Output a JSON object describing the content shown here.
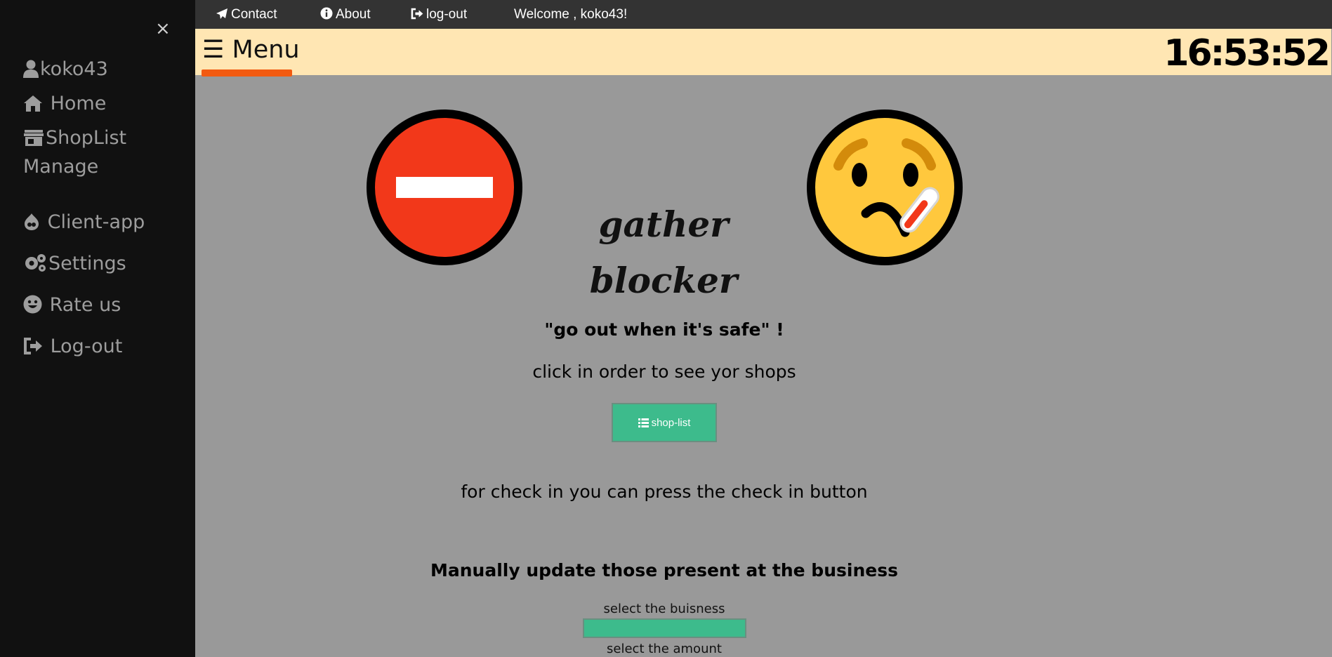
{
  "sidebar": {
    "close_label": "×",
    "items": [
      {
        "label": "koko43",
        "icon": "user-icon"
      },
      {
        "label": "Home",
        "icon": "home-icon"
      },
      {
        "label": "ShopList",
        "icon": "store-icon"
      },
      {
        "label": "Manage"
      },
      {
        "label": "Client-app",
        "icon": "drupal-icon"
      },
      {
        "label": "Settings",
        "icon": "gears-icon"
      },
      {
        "label": "Rate us",
        "icon": "smile-icon"
      },
      {
        "label": "Log-out",
        "icon": "sign-out-icon"
      }
    ]
  },
  "topnav": {
    "contact": "Contact",
    "about": "About",
    "logout": "log-out",
    "welcome": "Welcome , koko43!"
  },
  "menubar": {
    "menu_label": "☰ Menu",
    "clock": "16:53:52",
    "accent_color": "#f25a10",
    "background": "#ffe6b3"
  },
  "main": {
    "title": "gather blocker",
    "slogan": "\"go out when it's safe\" !",
    "click_text": "click in order to see yor shops",
    "shoplist_button": "shop-list",
    "checkin_text": "for check in you can press the check in button",
    "manual_heading": "Manually update those present at the business",
    "select_business_label": "select the buisness",
    "select_amount_label": "select the amount",
    "button_color": "#3dbb8c"
  }
}
